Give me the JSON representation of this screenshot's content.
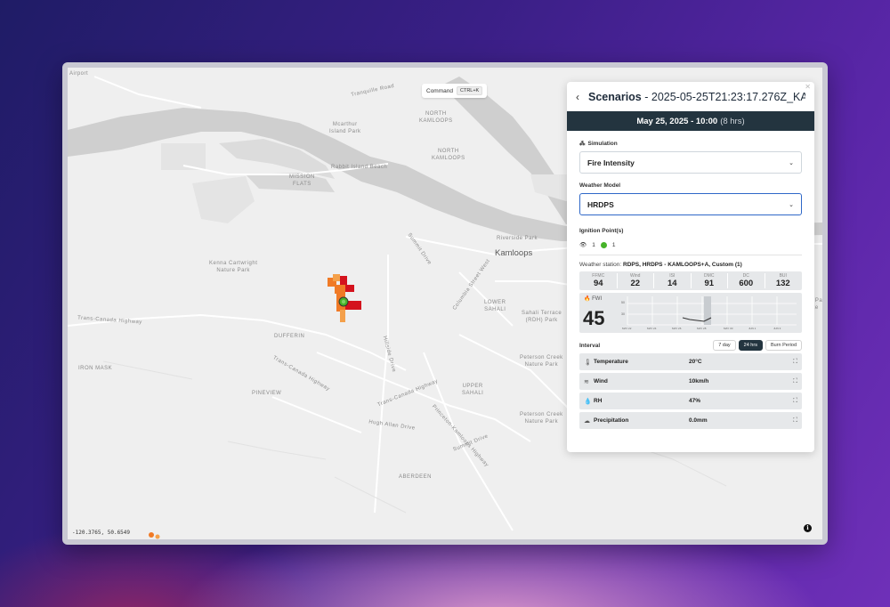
{
  "map": {
    "command_label": "Command",
    "command_shortcut": "CTRL+K",
    "coords": "-120.3765, 50.6549",
    "labels": {
      "airport": "Airport",
      "tranquille_road": "Tranquille Road",
      "mcarthur_island": "Mcarthur\nIsland Park",
      "north_kamloops_1": "NORTH\nKAMLOOPS",
      "north_kamloops_2": "NORTH\nKAMLOOPS",
      "rabbit_island": "Rabbit Island Beach",
      "mission_flats": "MISSION\nFLATS",
      "summit_drive": "Summit Drive",
      "riverside_park": "Riverside Park",
      "kamloops": "Kamloops",
      "columbia_street": "Columbia Street West",
      "kenna_cartwright": "Kenna Cartwright\nNature Park",
      "lower_sahali": "LOWER\nSAHALI",
      "sahali_terrace": "Sahali Terrace\n(RDH) Park",
      "trans_canada_1": "Trans-Canada Highway",
      "dufferin": "DUFFERIN",
      "iron_mask": "IRON MASK",
      "trans_canada_2": "Trans-Canada Highway",
      "hillside_drive": "Hillside Drive",
      "pineview": "PINEVIEW",
      "trans_canada_3": "Trans-Canada Highway",
      "peterson_creek_1": "Peterson Creek\nNature Park",
      "upper_sahali": "UPPER\nSAHALI",
      "peterson_creek_2": "Peterson Creek\nNature Park",
      "hugh_allan": "Hugh Allan Drive",
      "summit_drive_2": "Summit Drive",
      "princeton_kamloops": "Princeton-Kamloops Highway",
      "aberdeen": "ABERDEEN",
      "right_edge_1": "ne Park\nBike"
    }
  },
  "panel": {
    "title": "Scenarios",
    "title_suffix": " - 2025-05-25T21:23:17.276Z_KA...",
    "date": "May 25, 2025 - 10:00",
    "date_hours": "(8 hrs)",
    "simulation_label": "Simulation",
    "simulation_value": "Fire Intensity",
    "weather_model_label": "Weather Model",
    "weather_model_value": "HRDPS",
    "ignition_label": "Ignition Point(s)",
    "ignition_hidden_count": "1",
    "ignition_active_count": "1",
    "station_prefix": "Weather station:",
    "station_name": "RDPS, HRDPS - KAMLOOPS+A, Custom (1)",
    "fwi_indices": [
      {
        "key": "FFMC",
        "value": "94"
      },
      {
        "key": "Wind",
        "value": "22"
      },
      {
        "key": "ISI",
        "value": "14"
      },
      {
        "key": "DMC",
        "value": "91"
      },
      {
        "key": "DC",
        "value": "600"
      },
      {
        "key": "BUI",
        "value": "132"
      }
    ],
    "fwi_label": "FWI",
    "fwi_value": "45",
    "fwi_axis": {
      "y_ticks": [
        "50",
        "30"
      ],
      "x_ticks": [
        "MAY 22",
        "MAY 24",
        "MAY 26",
        "MAY 28",
        "MAY 30",
        "JUN 1",
        "JUN 3"
      ]
    },
    "interval_label": "Interval",
    "interval_options": [
      "7 day",
      "24 hrs",
      "Burn Period"
    ],
    "interval_selected": "24 hrs",
    "weather_rows": [
      {
        "name": "Temperature",
        "value": "20°C",
        "icon": "thermometer-wind-icon"
      },
      {
        "name": "Wind",
        "value": "10km/h",
        "icon": "wind-icon"
      },
      {
        "name": "RH",
        "value": "47%",
        "icon": "humidity-icon"
      },
      {
        "name": "Precipitation",
        "value": "0.0mm",
        "icon": "rain-cloud-icon"
      }
    ]
  },
  "colors": {
    "header_dark": "#23343f",
    "accent_blue": "#2f68c8",
    "ignition_green": "#46b329",
    "fire_red": "#d4121d",
    "fire_orange": "#f07a26"
  }
}
